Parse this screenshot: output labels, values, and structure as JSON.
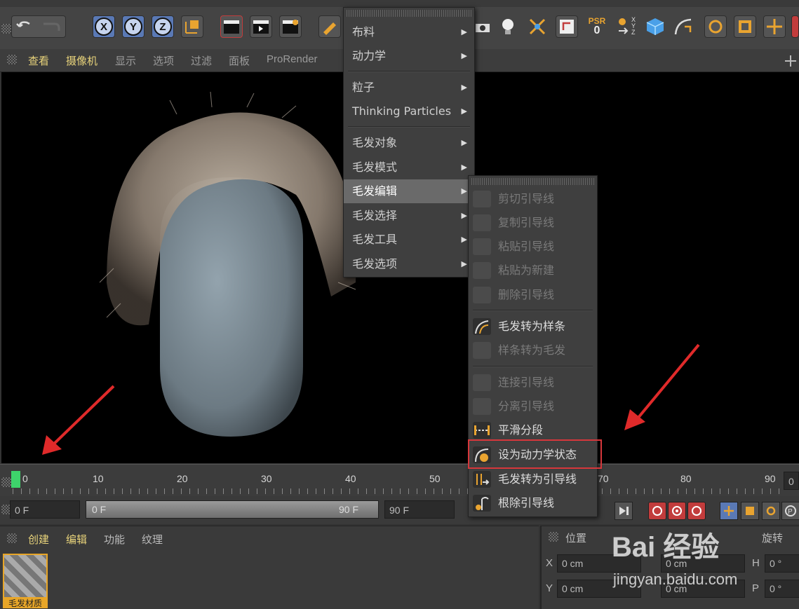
{
  "view_menu": {
    "items": [
      "查看",
      "摄像机",
      "显示",
      "选项",
      "过滤",
      "面板",
      "ProRender"
    ]
  },
  "toolbar": {
    "axes": [
      "X",
      "Y",
      "Z"
    ],
    "psr_label": "PSR",
    "psr_value": "0",
    "xyz_stack": "X Y Z"
  },
  "main_menu": {
    "items": [
      {
        "label": "布料",
        "submenu": true
      },
      {
        "label": "动力学",
        "submenu": true
      },
      {
        "label": "粒子",
        "submenu": true
      },
      {
        "label": "Thinking Particles",
        "submenu": true
      },
      {
        "label": "毛发对象",
        "submenu": true
      },
      {
        "label": "毛发模式",
        "submenu": true
      },
      {
        "label": "毛发编辑",
        "submenu": true,
        "active": true
      },
      {
        "label": "毛发选择",
        "submenu": true
      },
      {
        "label": "毛发工具",
        "submenu": true
      },
      {
        "label": "毛发选项",
        "submenu": true
      }
    ]
  },
  "hair_edit_menu": {
    "items": [
      {
        "label": "剪切引导线",
        "enabled": false,
        "icon": "cut-guides-icon"
      },
      {
        "label": "复制引导线",
        "enabled": false,
        "icon": "copy-guides-icon"
      },
      {
        "label": "粘贴引导线",
        "enabled": false,
        "icon": "paste-guides-icon"
      },
      {
        "label": "粘贴为新建",
        "enabled": false,
        "icon": "paste-as-new-icon"
      },
      {
        "label": "删除引导线",
        "enabled": false,
        "icon": "delete-guides-icon"
      },
      {
        "label": "毛发转为样条",
        "enabled": true,
        "icon": "hair-to-spline-icon"
      },
      {
        "label": "样条转为毛发",
        "enabled": false,
        "icon": "spline-to-hair-icon"
      },
      {
        "label": "连接引导线",
        "enabled": false,
        "icon": "connect-guides-icon"
      },
      {
        "label": "分离引导线",
        "enabled": false,
        "icon": "split-guides-icon"
      },
      {
        "label": "平滑分段",
        "enabled": true,
        "icon": "smooth-segments-icon"
      },
      {
        "label": "设为动力学状态",
        "enabled": true,
        "highlighted": true,
        "icon": "set-dynamics-state-icon"
      },
      {
        "label": "毛发转为引导线",
        "enabled": true,
        "icon": "hair-to-guides-icon"
      },
      {
        "label": "根除引导线",
        "enabled": true,
        "icon": "root-guides-icon"
      }
    ]
  },
  "timeline": {
    "ticks": [
      "0",
      "10",
      "20",
      "30",
      "40",
      "50",
      "60",
      "70",
      "80",
      "90"
    ],
    "end_field": "0"
  },
  "controls": {
    "current_frame": "0 F",
    "range_start": "0 F",
    "range_end": "90 F",
    "max_frame": "90 F"
  },
  "material_panel": {
    "menu": [
      "创建",
      "编辑",
      "功能",
      "纹理"
    ],
    "material_name": "毛发材质"
  },
  "coord_panel": {
    "position_header": "位置",
    "rotation_header": "旋转",
    "rows": [
      {
        "axis": "X",
        "value": "0 cm",
        "rot_axis": "H",
        "rot_value": "0 °"
      },
      {
        "axis": "Y",
        "value": "0 cm",
        "rot_axis": "P",
        "rot_value": "0 °"
      }
    ],
    "second_value": "0 cm"
  },
  "watermark": {
    "logo": "Bai 经验",
    "url": "jingyan.baidu.com"
  },
  "colors": {
    "accent_yellow": "#e7d27a",
    "highlight_red": "#d6373b",
    "playhead_green": "#3ed36b",
    "axis_blue": "#5a79b5",
    "material_orange": "#e8a628"
  }
}
